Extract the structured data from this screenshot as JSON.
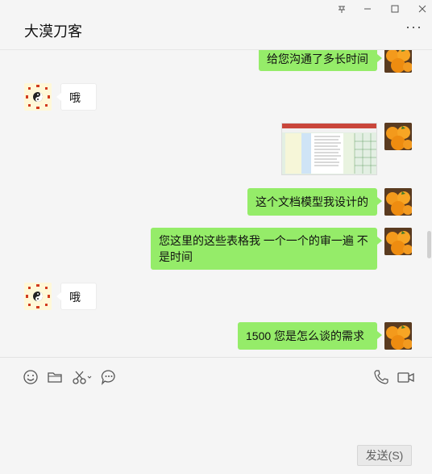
{
  "window": {
    "title": "大漠刀客",
    "pin_icon": "pin-icon",
    "minimize_icon": "minimize-icon",
    "maximize_icon": "maximize-icon",
    "close_icon": "close-icon",
    "more_label": "···"
  },
  "messages": [
    {
      "from": "me",
      "text": "给您沟通了多长时间"
    },
    {
      "from": "them",
      "text": "哦"
    },
    {
      "from": "me",
      "type": "image",
      "description": "spreadsheet-screenshot"
    },
    {
      "from": "me",
      "text": "这个文档模型我设计的"
    },
    {
      "from": "me",
      "text": "您这里的这些表格我 一个一个的审一遍 不是时间"
    },
    {
      "from": "them",
      "text": "哦"
    },
    {
      "from": "me",
      "text": "1500 您是怎么谈的需求"
    }
  ],
  "toolbar": {
    "icons": [
      "emoji-icon",
      "folder-icon",
      "scissors-icon",
      "chat-history-icon",
      "phone-icon",
      "video-icon"
    ]
  },
  "compose": {
    "value": "",
    "send_label": "发送(S)"
  },
  "colors": {
    "my_bubble": "#95ec69",
    "their_bubble": "#ffffff",
    "background": "#f5f5f5"
  }
}
